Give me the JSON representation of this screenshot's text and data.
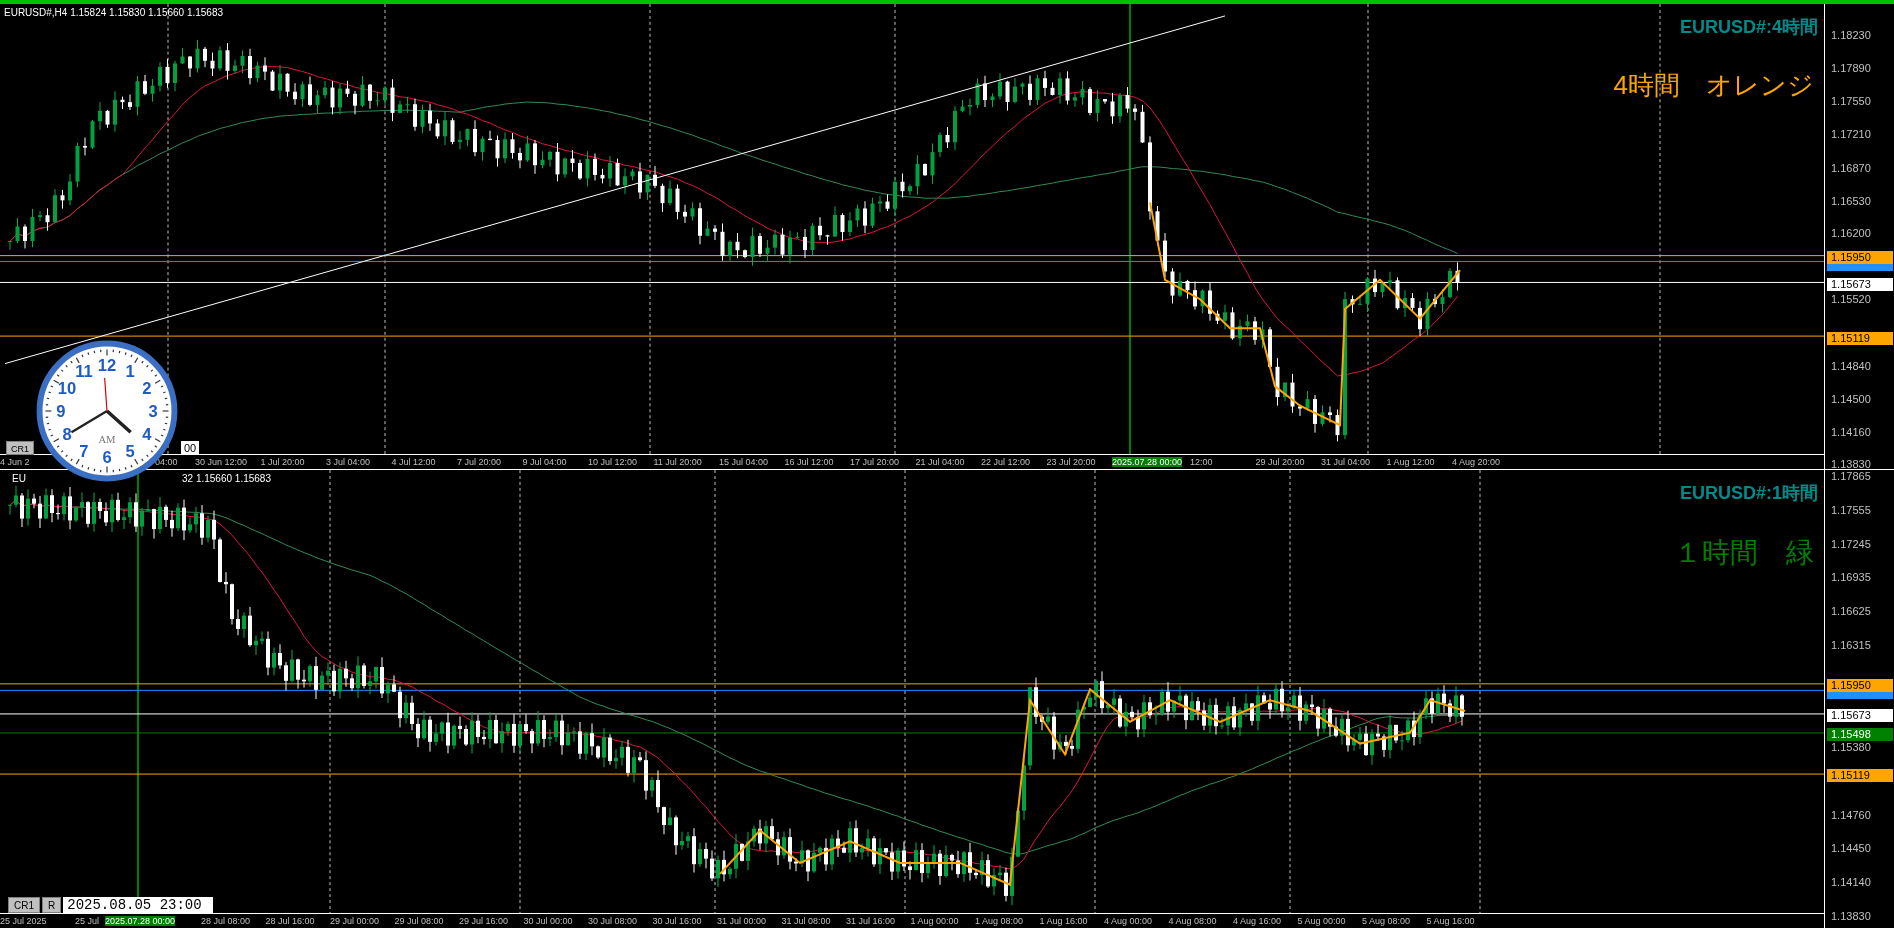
{
  "top_chart": {
    "header": "EURUSD#,H4  1.15824 1.15830 1.15660 1.15683",
    "title": "EURUSD#:4時間",
    "note": "4時間　オレンジ",
    "y_ticks": [
      "1.18230",
      "1.17890",
      "1.17550",
      "1.17210",
      "1.16870",
      "1.16530",
      "1.16200",
      "1.15520",
      "1.14840",
      "1.14500",
      "1.14160",
      "1.13830"
    ],
    "price_tags": [
      {
        "label": "1.15950",
        "color": "#ffa500"
      },
      {
        "color": "#1e90ff"
      },
      {
        "label": "1.15673",
        "color": "#ffffff"
      },
      {
        "label": "1.15119",
        "color": "#ffa500"
      }
    ],
    "x_labels": [
      {
        "label": "4 Jun 2",
        "selected": false
      },
      {
        "label": "04:00",
        "selected": false
      },
      {
        "label": "30 Jun 12:00",
        "selected": false
      },
      {
        "label": "1 Jul 20:00",
        "selected": false
      },
      {
        "label": "3 Jul 04:00",
        "selected": false
      },
      {
        "label": "4 Jul 12:00",
        "selected": false
      },
      {
        "label": "7 Jul 20:00",
        "selected": false
      },
      {
        "label": "9 Jul 04:00",
        "selected": false
      },
      {
        "label": "10 Jul 12:00",
        "selected": false
      },
      {
        "label": "11 Jul 20:00",
        "selected": false
      },
      {
        "label": "15 Jul 04:00",
        "selected": false
      },
      {
        "label": "16 Jul 12:00",
        "selected": false
      },
      {
        "label": "17 Jul 20:00",
        "selected": false
      },
      {
        "label": "21 Jul 04:00",
        "selected": false
      },
      {
        "label": "22 Jul 12:00",
        "selected": false
      },
      {
        "label": "23 Jul 20:00",
        "selected": false
      },
      {
        "label": "2025.07.28 00:00",
        "selected": true
      },
      {
        "label": "12:00",
        "selected": false
      },
      {
        "label": "29 Jul 20:00",
        "selected": false
      },
      {
        "label": "31 Jul 04:00",
        "selected": false
      },
      {
        "label": "1 Aug 12:00",
        "selected": false
      },
      {
        "label": "4 Aug 20:00",
        "selected": false
      }
    ],
    "crosshair_button": "CR1",
    "date_field": "00"
  },
  "bottom_chart": {
    "header_start": "EU",
    "header": "32 1.15660 1.15683",
    "title": "EURUSD#:1時間",
    "note": "１時間　緑",
    "y_ticks": [
      "1.17865",
      "1.17555",
      "1.17245",
      "1.16935",
      "1.16625",
      "1.16315",
      "1.15380",
      "1.14760",
      "1.14450",
      "1.14140",
      "1.13830"
    ],
    "price_tags": [
      {
        "label": "1.15950",
        "color": "#ffa500"
      },
      {
        "color": "#1e90ff"
      },
      {
        "label": "1.15673",
        "color": "#ffffff"
      },
      {
        "label": "1.15498",
        "color": "#008000"
      },
      {
        "label": "1.15119",
        "color": "#ffa500"
      }
    ],
    "x_labels": [
      {
        "label": "25 Jul 2025",
        "selected": false
      },
      {
        "label": "25 Jul",
        "selected": false
      },
      {
        "label": "2025.07.28 00:00",
        "selected": true
      },
      {
        "label": "28 Jul 08:00",
        "selected": false
      },
      {
        "label": "28 Jul 16:00",
        "selected": false
      },
      {
        "label": "29 Jul 00:00",
        "selected": false
      },
      {
        "label": "29 Jul 08:00",
        "selected": false
      },
      {
        "label": "29 Jul 16:00",
        "selected": false
      },
      {
        "label": "30 Jul 00:00",
        "selected": false
      },
      {
        "label": "30 Jul 08:00",
        "selected": false
      },
      {
        "label": "30 Jul 16:00",
        "selected": false
      },
      {
        "label": "31 Jul 00:00",
        "selected": false
      },
      {
        "label": "31 Jul 08:00",
        "selected": false
      },
      {
        "label": "31 Jul 16:00",
        "selected": false
      },
      {
        "label": "1 Aug 00:00",
        "selected": false
      },
      {
        "label": "1 Aug 08:00",
        "selected": false
      },
      {
        "label": "1 Aug 16:00",
        "selected": false
      },
      {
        "label": "4 Aug 00:00",
        "selected": false
      },
      {
        "label": "4 Aug 08:00",
        "selected": false
      },
      {
        "label": "4 Aug 16:00",
        "selected": false
      },
      {
        "label": "5 Aug 00:00",
        "selected": false
      },
      {
        "label": "5 Aug 08:00",
        "selected": false
      },
      {
        "label": "5 Aug 16:00",
        "selected": false
      }
    ],
    "crosshair_button": "CR1",
    "reset_button": "R",
    "date_field": "2025.08.05 23:00"
  },
  "clock": {
    "numerals": [
      "11",
      "12",
      "1",
      "10",
      "2",
      "9",
      "3",
      "8",
      "4",
      "7",
      "6",
      "5"
    ],
    "period": "AM"
  }
}
